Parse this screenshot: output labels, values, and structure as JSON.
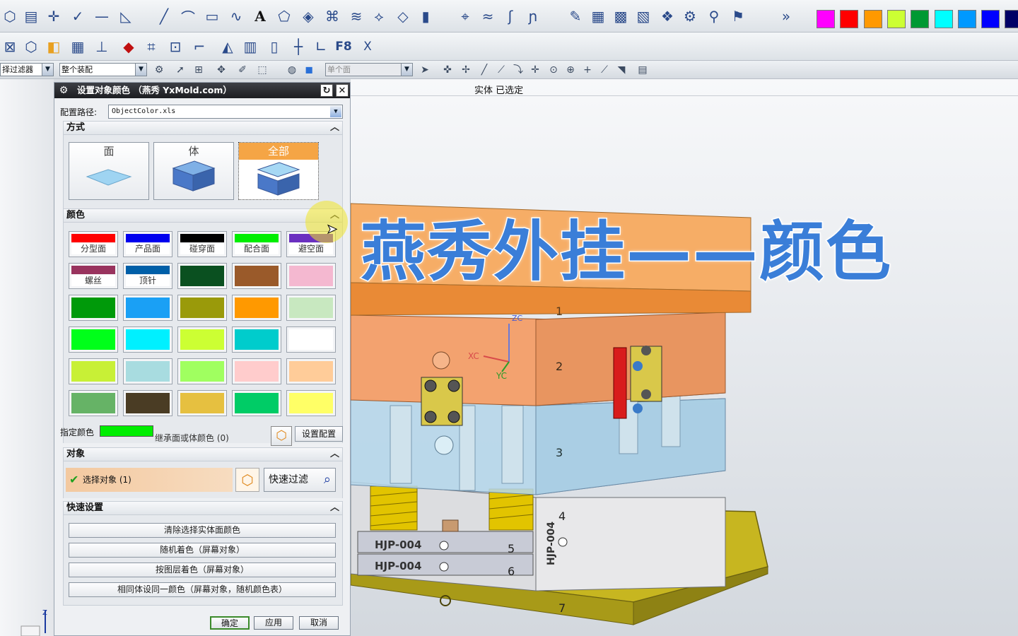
{
  "toolbar": {
    "swatch_colors": [
      "#ff00ff",
      "#ff0000",
      "#ff9900",
      "#ccff33",
      "#009933",
      "#00ffff",
      "#0099ff",
      "#0000ff",
      "#000066"
    ],
    "row2_texts": [
      "F8",
      "X"
    ],
    "selection_filter": "择过滤器",
    "assembly_scope": "整个装配",
    "face_rule": "单个面"
  },
  "status": {
    "text": "实体  已选定"
  },
  "dialog": {
    "title": "设置对象颜色  （燕秀 YxMold.com）",
    "config_path_label": "配置路径:",
    "config_path_value": "ObjectColor.xls",
    "mode_section": "方式",
    "modes": [
      {
        "label": "面"
      },
      {
        "label": "体"
      },
      {
        "label": "全部"
      }
    ],
    "color_section": "颜色",
    "colors": [
      {
        "color": "#ff0000",
        "label": "分型面"
      },
      {
        "color": "#0000ee",
        "label": "产品面"
      },
      {
        "color": "#000000",
        "label": "碰穿面"
      },
      {
        "color": "#00ee00",
        "label": "配合面"
      },
      {
        "color": "#6a2fc0",
        "label": "避空面"
      },
      {
        "color": "#99335e",
        "label": "螺丝"
      },
      {
        "color": "#005fa8",
        "label": "顶针"
      },
      {
        "color": "#0a5020"
      },
      {
        "color": "#9a5a2a"
      },
      {
        "color": "#f4b8d0"
      },
      {
        "color": "#009a0a"
      },
      {
        "color": "#1aa0f5"
      },
      {
        "color": "#9a9a0a"
      },
      {
        "color": "#ff9900"
      },
      {
        "color": "#c8e8c0"
      },
      {
        "color": "#00ff1a"
      },
      {
        "color": "#00f0ff"
      },
      {
        "color": "#ccff33"
      },
      {
        "color": "#00cccc"
      },
      {
        "color": "#ffffff"
      },
      {
        "color": "#c8f036"
      },
      {
        "color": "#a8dce0"
      },
      {
        "color": "#a0ff60"
      },
      {
        "color": "#ffcccc"
      },
      {
        "color": "#ffcc99"
      },
      {
        "color": "#66b366"
      },
      {
        "color": "#4a3c24"
      },
      {
        "color": "#e6c040"
      },
      {
        "color": "#00cc66"
      },
      {
        "color": "#ffff66"
      }
    ],
    "specified_color_label": "指定颜色",
    "specified_color": "#00ee00",
    "inherit_label": "继承面或体颜色  (0)",
    "setup_button": "设置配置",
    "object_section": "对象",
    "select_object": "选择对象  (1)",
    "quick_filter": "快速过滤",
    "quick_section": "快速设置",
    "quick_buttons": [
      "清除选择实体面颜色",
      "随机着色（屏幕对象）",
      "按图层着色（屏幕对象）",
      "相同体设同一颜色（屏幕对象，随机颜色表）"
    ],
    "ok": "确定",
    "apply": "应用",
    "cancel": "取消"
  },
  "overlay_text": "燕秀外挂——颜色",
  "model": {
    "plate_numbers": [
      "1",
      "2",
      "3",
      "4",
      "5",
      "6",
      "7"
    ],
    "engraving": "HJP-004",
    "axes": {
      "x": "XC",
      "y": "YC",
      "z": "ZC"
    }
  }
}
